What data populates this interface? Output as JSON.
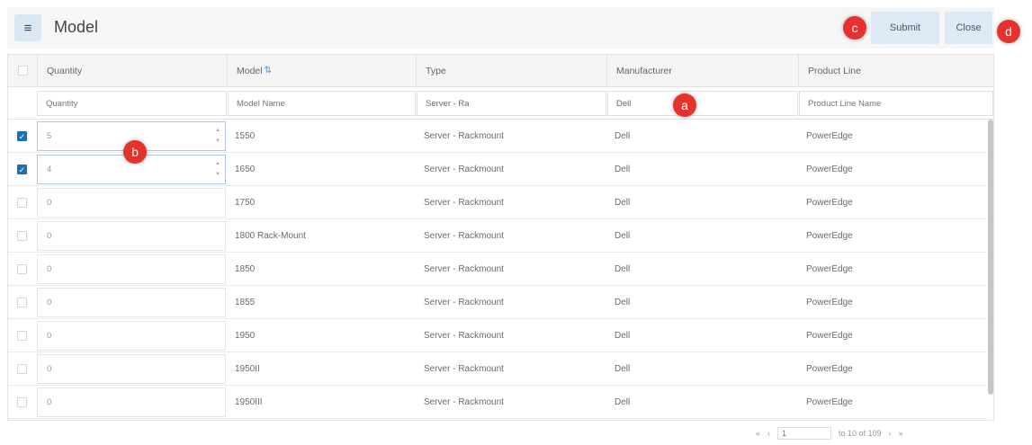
{
  "header": {
    "menu_icon": "hamburger-menu-icon",
    "title": "Model",
    "submit_label": "Submit",
    "close_label": "Close"
  },
  "callouts": {
    "a": "a",
    "b": "b",
    "c": "c",
    "d": "d"
  },
  "columns": {
    "quantity": "Quantity",
    "model": "Model",
    "type": "Type",
    "manufacturer": "Manufacturer",
    "product_line": "Product Line"
  },
  "filters": {
    "quantity_placeholder": "Quantity",
    "model_placeholder": "Model Name",
    "type_value": "Server - Ra",
    "manufacturer_value": "Dell",
    "product_line_placeholder": "Product Line Name"
  },
  "rows": [
    {
      "checked": true,
      "quantity": "5",
      "model": "1550",
      "type": "Server - Rackmount",
      "manufacturer": "Dell",
      "product_line": "PowerEdge"
    },
    {
      "checked": true,
      "quantity": "4",
      "model": "1650",
      "type": "Server - Rackmount",
      "manufacturer": "Dell",
      "product_line": "PowerEdge"
    },
    {
      "checked": false,
      "quantity": "0",
      "model": "1750",
      "type": "Server - Rackmount",
      "manufacturer": "Dell",
      "product_line": "PowerEdge"
    },
    {
      "checked": false,
      "quantity": "0",
      "model": "1800 Rack-Mount",
      "type": "Server - Rackmount",
      "manufacturer": "Dell",
      "product_line": "PowerEdge"
    },
    {
      "checked": false,
      "quantity": "0",
      "model": "1850",
      "type": "Server - Rackmount",
      "manufacturer": "Dell",
      "product_line": "PowerEdge"
    },
    {
      "checked": false,
      "quantity": "0",
      "model": "1855",
      "type": "Server - Rackmount",
      "manufacturer": "Dell",
      "product_line": "PowerEdge"
    },
    {
      "checked": false,
      "quantity": "0",
      "model": "1950",
      "type": "Server - Rackmount",
      "manufacturer": "Dell",
      "product_line": "PowerEdge"
    },
    {
      "checked": false,
      "quantity": "0",
      "model": "1950II",
      "type": "Server - Rackmount",
      "manufacturer": "Dell",
      "product_line": "PowerEdge"
    },
    {
      "checked": false,
      "quantity": "0",
      "model": "1950III",
      "type": "Server - Rackmount",
      "manufacturer": "Dell",
      "product_line": "PowerEdge"
    }
  ],
  "pager": {
    "first": "«",
    "prev": "‹",
    "page": "1",
    "range_text": "to 10 of 109",
    "next": "›",
    "last": "»"
  },
  "colors": {
    "accent": "#1e6fb5",
    "callout": "#e5322d",
    "button_bg": "#dde9f4"
  }
}
